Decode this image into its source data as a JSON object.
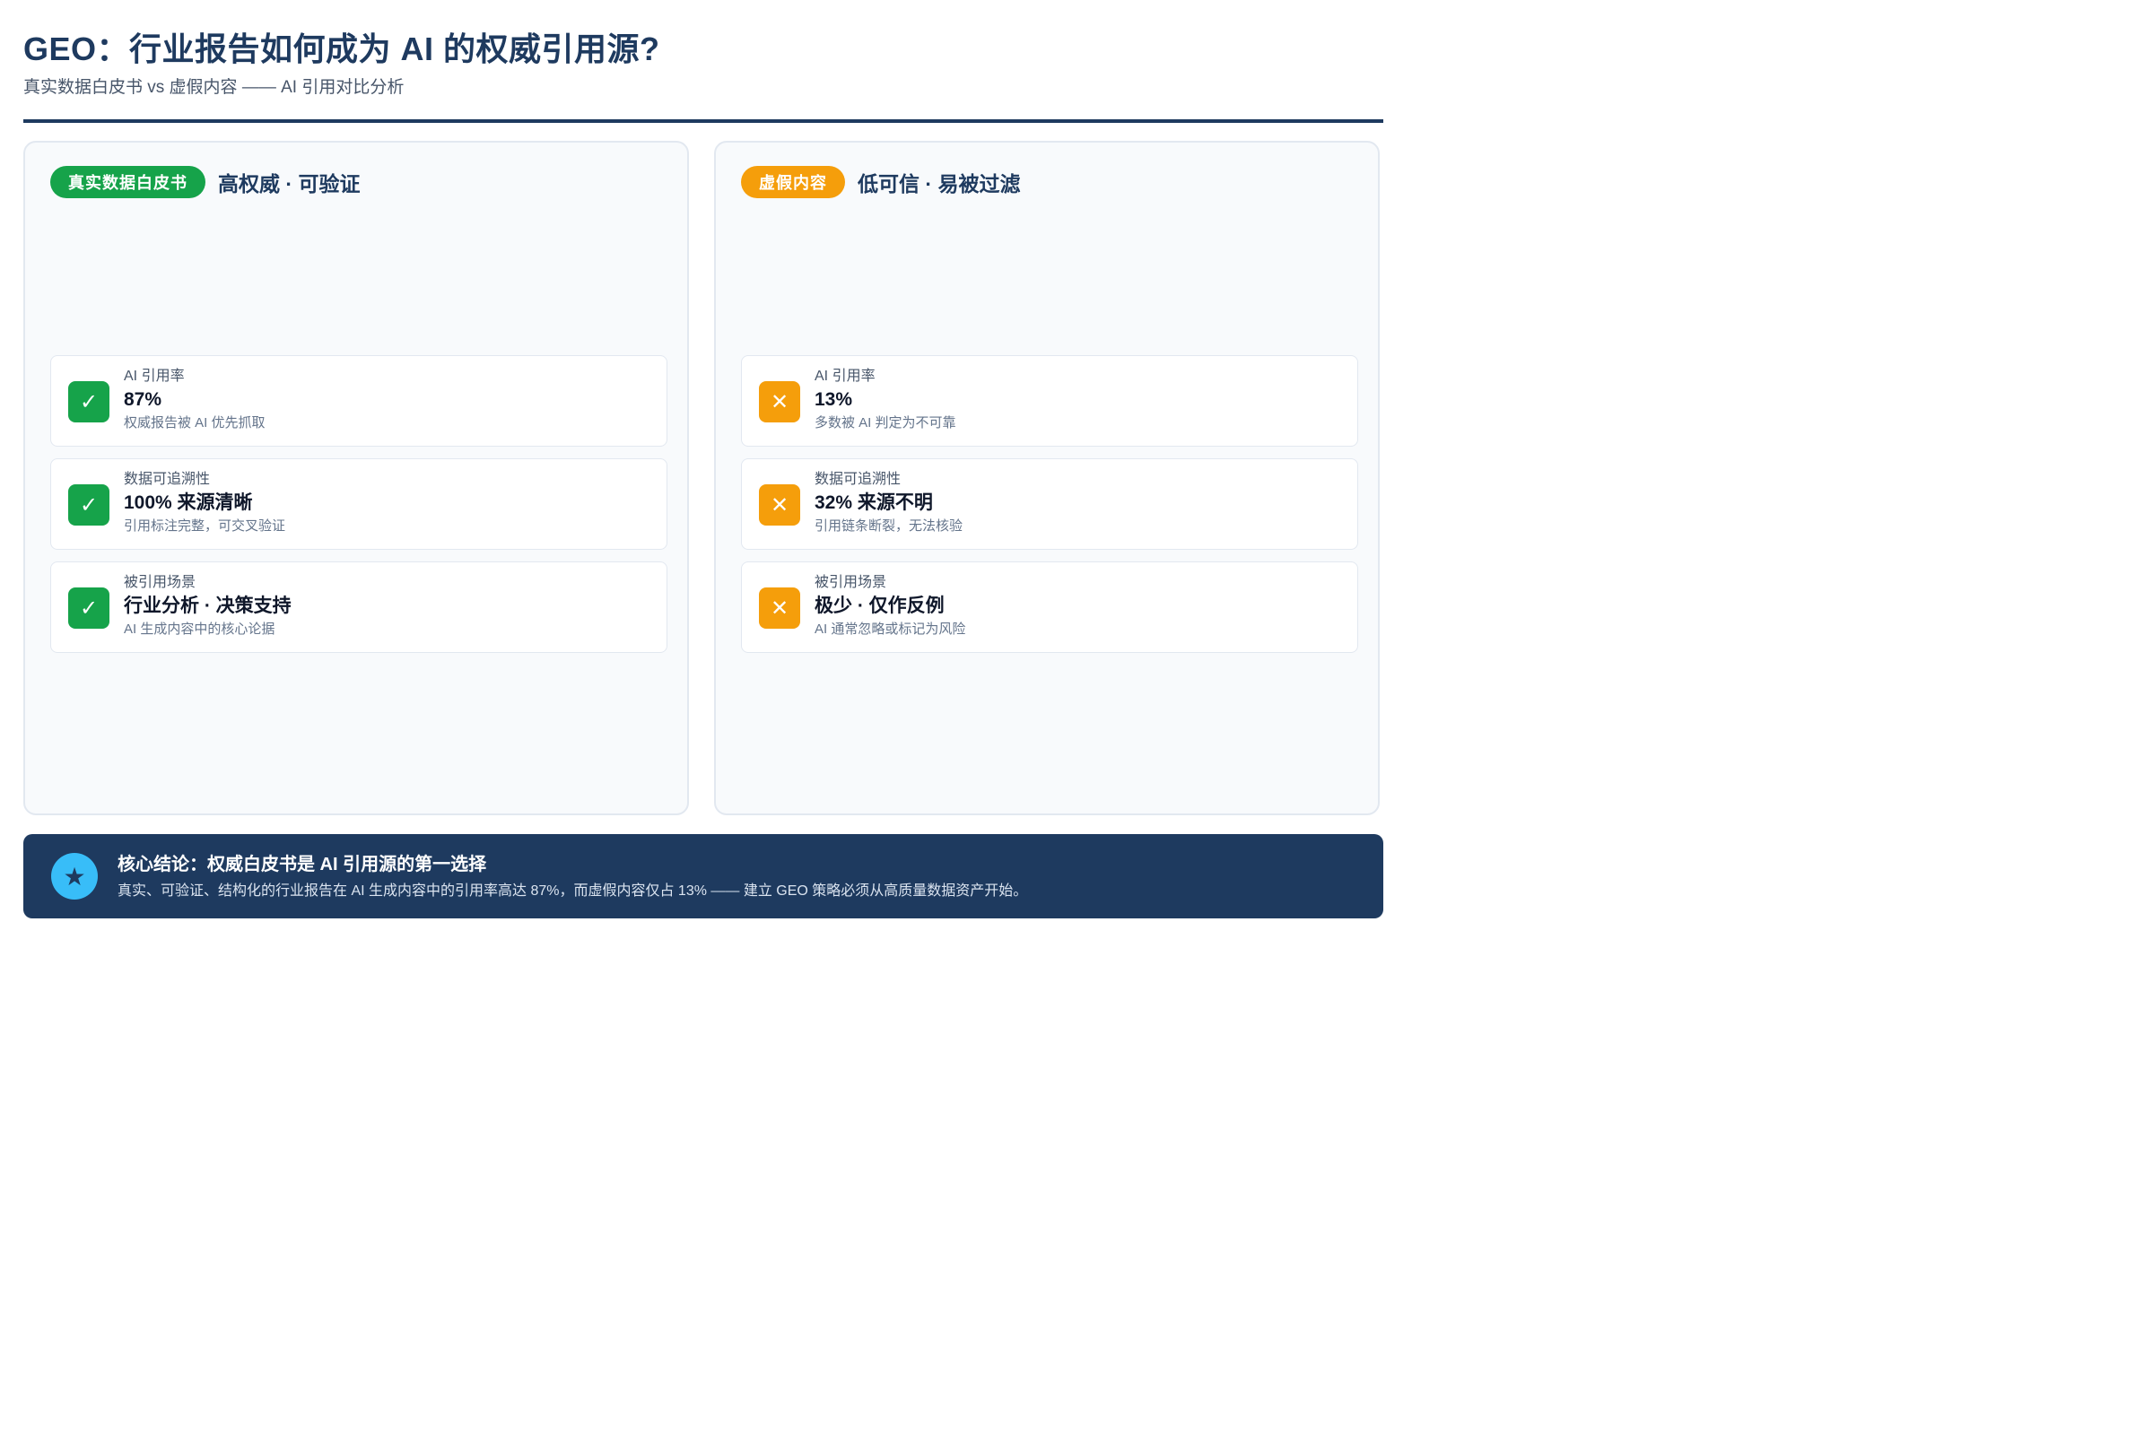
{
  "header": {
    "title": "GEO：行业报告如何成为 AI 的权威引用源?",
    "subtitle": "真实数据白皮书 vs 虚假内容 —— AI 引用对比分析"
  },
  "left": {
    "badge": "真实数据白皮书",
    "tag": "高权威 · 可验证",
    "icon": "check-icon",
    "color": "#16a34a",
    "cards": [
      {
        "label": "AI 引用率",
        "value": "87%",
        "desc": "权威报告被 AI 优先抓取"
      },
      {
        "label": "数据可追溯性",
        "value": "100% 来源清晰",
        "desc": "引用标注完整，可交叉验证"
      },
      {
        "label": "被引用场景",
        "value": "行业分析 · 决策支持",
        "desc": "AI 生成内容中的核心论据"
      }
    ]
  },
  "right": {
    "badge": "虚假内容",
    "tag": "低可信 · 易被过滤",
    "icon": "cross-icon",
    "color": "#f59e0b",
    "cards": [
      {
        "label": "AI 引用率",
        "value": "13%",
        "desc": "多数被 AI 判定为不可靠"
      },
      {
        "label": "数据可追溯性",
        "value": "32% 来源不明",
        "desc": "引用链条断裂，无法核验"
      },
      {
        "label": "被引用场景",
        "value": "极少 · 仅作反例",
        "desc": "AI 通常忽略或标记为风险"
      }
    ]
  },
  "footer": {
    "icon": "star-icon",
    "title": "核心结论：权威白皮书是 AI 引用源的第一选择",
    "text": "真实、可验证、结构化的行业报告在 AI 生成内容中的引用率高达 87%，而虚假内容仅占 13% —— 建立 GEO 策略必须从高质量数据资产开始。"
  }
}
